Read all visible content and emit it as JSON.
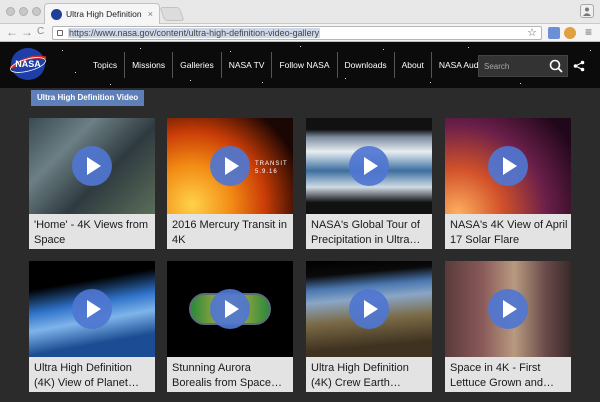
{
  "browser": {
    "tab_title": "Ultra High Definition Video",
    "tab_close": "×",
    "url": "https://www.nasa.gov/content/ultra-high-definition-video-gallery",
    "back": "←",
    "forward": "→",
    "reload": "C",
    "bookmark_star": "☆",
    "menu": "≡",
    "profile": "👤"
  },
  "header": {
    "logo_text": "NASA",
    "nav": [
      "Topics",
      "Missions",
      "Galleries",
      "NASA TV",
      "Follow NASA",
      "Downloads",
      "About",
      "NASA Audiences"
    ],
    "search_placeholder": "Search"
  },
  "page": {
    "label": "Ultra High Definition Video"
  },
  "videos": [
    {
      "title": "'Home' - 4K Views from Space"
    },
    {
      "title": "2016 Mercury Transit in 4K",
      "overlay": "TRANSIT 5.9.16"
    },
    {
      "title": "NASA's Global Tour of Precipitation in Ultra…"
    },
    {
      "title": "NASA's 4K View of April 17 Solar Flare"
    },
    {
      "title": "Ultra High Definition (4K) View of Planet…"
    },
    {
      "title": "Stunning Aurora Borealis from Space…"
    },
    {
      "title": "Ultra High Definition (4K) Crew Earth…"
    },
    {
      "title": "Space in 4K - First Lettuce Grown and…"
    }
  ],
  "colors": {
    "accent": "#5f7fb8",
    "play": "#4f76d1",
    "header_bg": "#0b0b0b",
    "page_bg": "#2b2b2b"
  }
}
